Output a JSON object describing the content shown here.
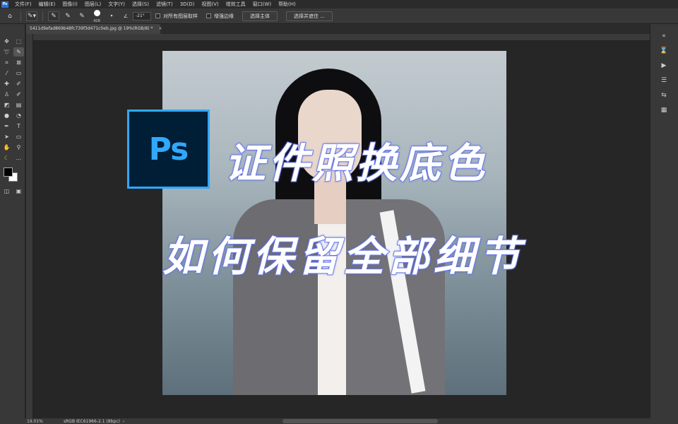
{
  "menubar": {
    "logo": "Ps",
    "items": [
      "文件(F)",
      "编辑(E)",
      "图像(I)",
      "图层(L)",
      "文字(Y)",
      "选择(S)",
      "滤镜(T)",
      "3D(D)",
      "视图(V)",
      "增效工具",
      "窗口(W)",
      "帮助(H)"
    ]
  },
  "options": {
    "brush_size": "428",
    "angle": "-21°",
    "sample_all_layers": "对所有图层取样",
    "enhance_edge": "增强边缘",
    "select_subject": "选择主体",
    "select_and_mask": "选择并遮住 ..."
  },
  "document": {
    "tab_title": "5411d9efad869b48fc739f3d471c0eb.jpg @ 19%(RGB/8) *",
    "tab_close": "×"
  },
  "overlay": {
    "badge": "Ps",
    "line1": "证件照换底色",
    "line2": "如何保留全部细节"
  },
  "status": {
    "zoom": "19.01%",
    "profile": "sRGB IEC61966-2.1 (8bpc)"
  },
  "colors": {
    "ps_blue": "#31a8ff",
    "ps_dark": "#001e36",
    "text_stroke": "#7b8cf0"
  }
}
